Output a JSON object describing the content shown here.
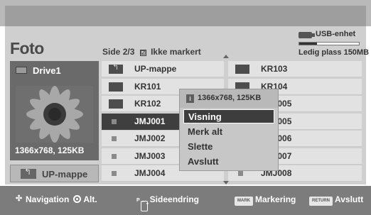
{
  "header": {
    "title": "Foto",
    "page_prefix": "Side",
    "page_current": "2/3",
    "check_glyph": "☑",
    "marked_status": "Ikke markert"
  },
  "usb": {
    "label": "USB-enhet",
    "free_space": "Ledig plass 150MB",
    "usage_fraction": 0.3
  },
  "sidebar": {
    "drive_label": "Drive1",
    "thumb_resolution": "1366x768, 125KB",
    "up_button_label": "UP-mappe"
  },
  "grid": {
    "items": [
      {
        "label": "UP-mappe",
        "type": "up-folder"
      },
      {
        "label": "KR103",
        "type": "folder"
      },
      {
        "label": "KR101",
        "type": "folder"
      },
      {
        "label": "KR104",
        "type": "folder"
      },
      {
        "label": "KR102",
        "type": "folder"
      },
      {
        "label": "JMJ005",
        "type": "file"
      },
      {
        "label": "JMJ001",
        "type": "file",
        "selected": true
      },
      {
        "label": "JMJ005",
        "type": "file"
      },
      {
        "label": "JMJ002",
        "type": "file"
      },
      {
        "label": "JMJ006",
        "type": "file"
      },
      {
        "label": "JMJ003",
        "type": "file"
      },
      {
        "label": "JMJ007",
        "type": "file"
      },
      {
        "label": "JMJ004",
        "type": "file"
      },
      {
        "label": "JMJ008",
        "type": "file"
      }
    ]
  },
  "popup": {
    "info_icon": "i",
    "header": "1366x768, 125KB",
    "options": [
      "Visning",
      "Merk alt",
      "Slette",
      "Avslutt"
    ],
    "highlighted_index": 0
  },
  "footer": {
    "navigation": "Navigation",
    "ok_alt": "Alt.",
    "page_key": "P",
    "page_change": "Sideendring",
    "mark_key": "MARK",
    "mark_label": "Markering",
    "return_key": "RETURN",
    "return_label": "Avslutt"
  },
  "colors": {
    "panel": "#cfcfcf",
    "selected_row": "#3f3f3f",
    "footer": "#7c7c7c"
  }
}
